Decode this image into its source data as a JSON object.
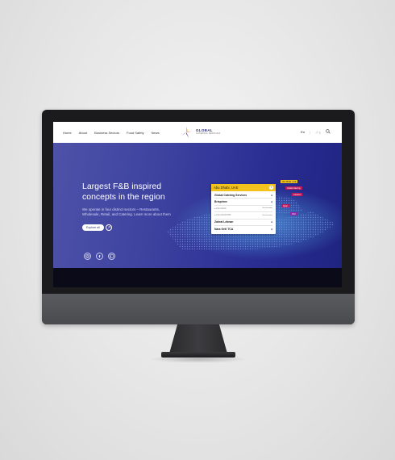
{
  "nav": {
    "links": [
      "Home",
      "About",
      "Business Sectors",
      "Food Safety",
      "News"
    ],
    "brand_name": "GLOBAL",
    "brand_sub": "CATERING SERVICES",
    "lang_active": "En",
    "lang_sep": "|",
    "lang_other": "ع ك"
  },
  "hero": {
    "title": "Largest F&B inspired concepts in the region",
    "description": "We operate in four distinct sectors – Restaurants, Wholesale, Retail, and Catering. Learn more about them",
    "explore_label": "Explore all",
    "colors": {
      "start": "#4e52a8",
      "end": "#1f2380",
      "accent": "#f4c21c"
    }
  },
  "location_card": {
    "title": "Abu Dhabi, UAE",
    "close_icon": "×",
    "rows": [
      {
        "name": "Global Catering Services",
        "sub": ""
      },
      {
        "name": "Brisprime",
        "sub": ""
      },
      {
        "name": "",
        "sub": "● Abu DHUF",
        "tag": "View location"
      },
      {
        "name": "",
        "sub": "● Abu DHAR RNF",
        "tag": "View location"
      },
      {
        "name": "Zahrat Lebnan",
        "sub": ""
      },
      {
        "name": "Nara Grill TCA",
        "sub": ""
      }
    ]
  },
  "map_tags": [
    {
      "text": "Abu Dhabi, UAE",
      "color": "#f4c21c",
      "text_color": "#222"
    },
    {
      "text": "Global Catering",
      "color": "#c2185b"
    },
    {
      "text": "Lebanon",
      "color": "#c2185b"
    },
    {
      "text": "Qatar",
      "color": "#c2185b"
    },
    {
      "text": "KSA",
      "color": "#8e24aa"
    }
  ],
  "socials": [
    "instagram-icon",
    "facebook-icon",
    "linkedin-icon"
  ]
}
